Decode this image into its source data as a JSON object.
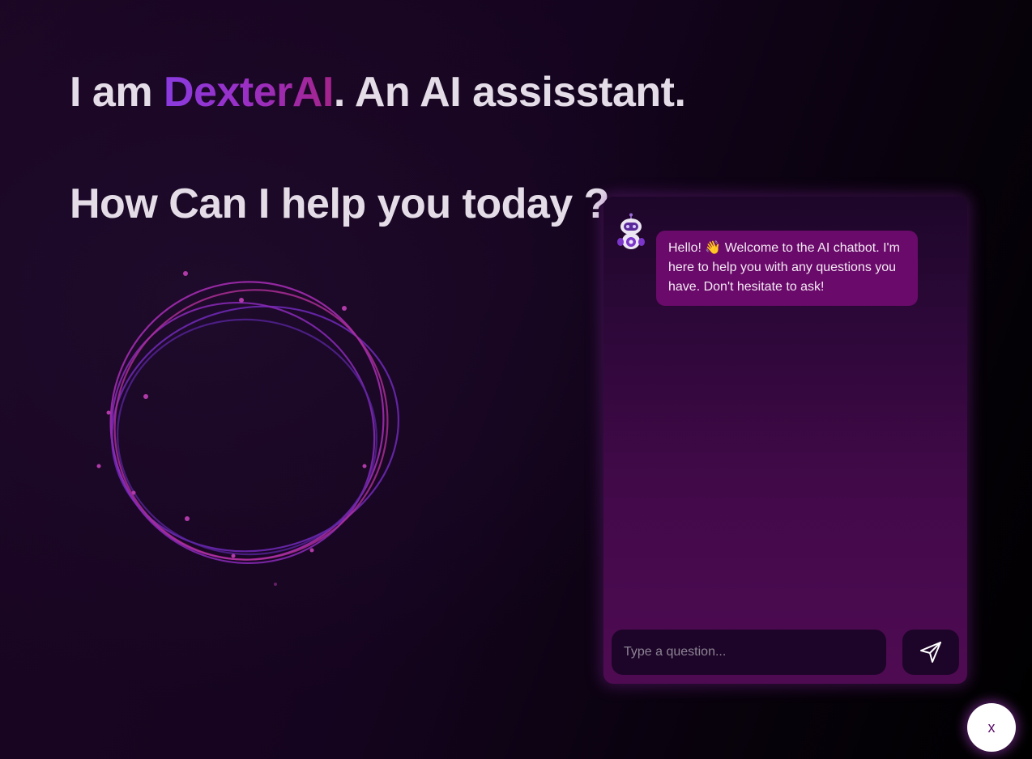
{
  "hero": {
    "prefix": "I am ",
    "brand": "DexterAI",
    "suffix": ". An AI assisstant.",
    "subtitle": "How Can I help you today ?"
  },
  "chat": {
    "bot_message": "Hello! 👋 Welcome to the AI chatbot. I'm here to help you with any questions you have. Don't hesitate to ask!",
    "input": {
      "value": "",
      "placeholder": "Type a question..."
    },
    "send_icon": "paper-plane-icon",
    "avatar_icon": "robot-icon"
  },
  "close_button": {
    "label": "x"
  },
  "colors": {
    "accent_purple": "#8a3be0",
    "accent_magenta": "#a3238a",
    "bubble": "#6a0a6a",
    "input_bg": "#1d0529",
    "close_text": "#5a0d6a"
  }
}
